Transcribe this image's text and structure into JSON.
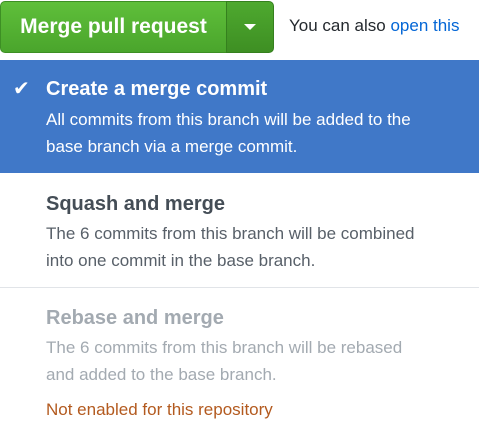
{
  "top_bar": {
    "merge_button_label": "Merge pull request",
    "dropdown_icon": "caret-down-icon",
    "also_prefix": "You can also ",
    "also_link": "open this"
  },
  "menu": {
    "options": [
      {
        "title": "Create a merge commit",
        "description_line1": "All commits from this branch will be added to the",
        "description_line2": "base branch via a merge commit.",
        "selected": true,
        "icon": "check-icon"
      },
      {
        "title": "Squash and merge",
        "description_line1": "The 6 commits from this branch will be combined",
        "description_line2": "into one commit in the base branch.",
        "selected": false
      },
      {
        "title": "Rebase and merge",
        "description_line1": "The 6 commits from this branch will be rebased",
        "description_line2": "and added to the base branch.",
        "selected": false,
        "disabled": true,
        "warning": "Not enabled for this repository"
      }
    ]
  },
  "colors": {
    "merge_green": "#4aa52c",
    "selected_blue": "#4078c8",
    "link_blue": "#0366d6",
    "warning_orange": "#b35a1f",
    "disabled_gray": "#a3aab1"
  }
}
